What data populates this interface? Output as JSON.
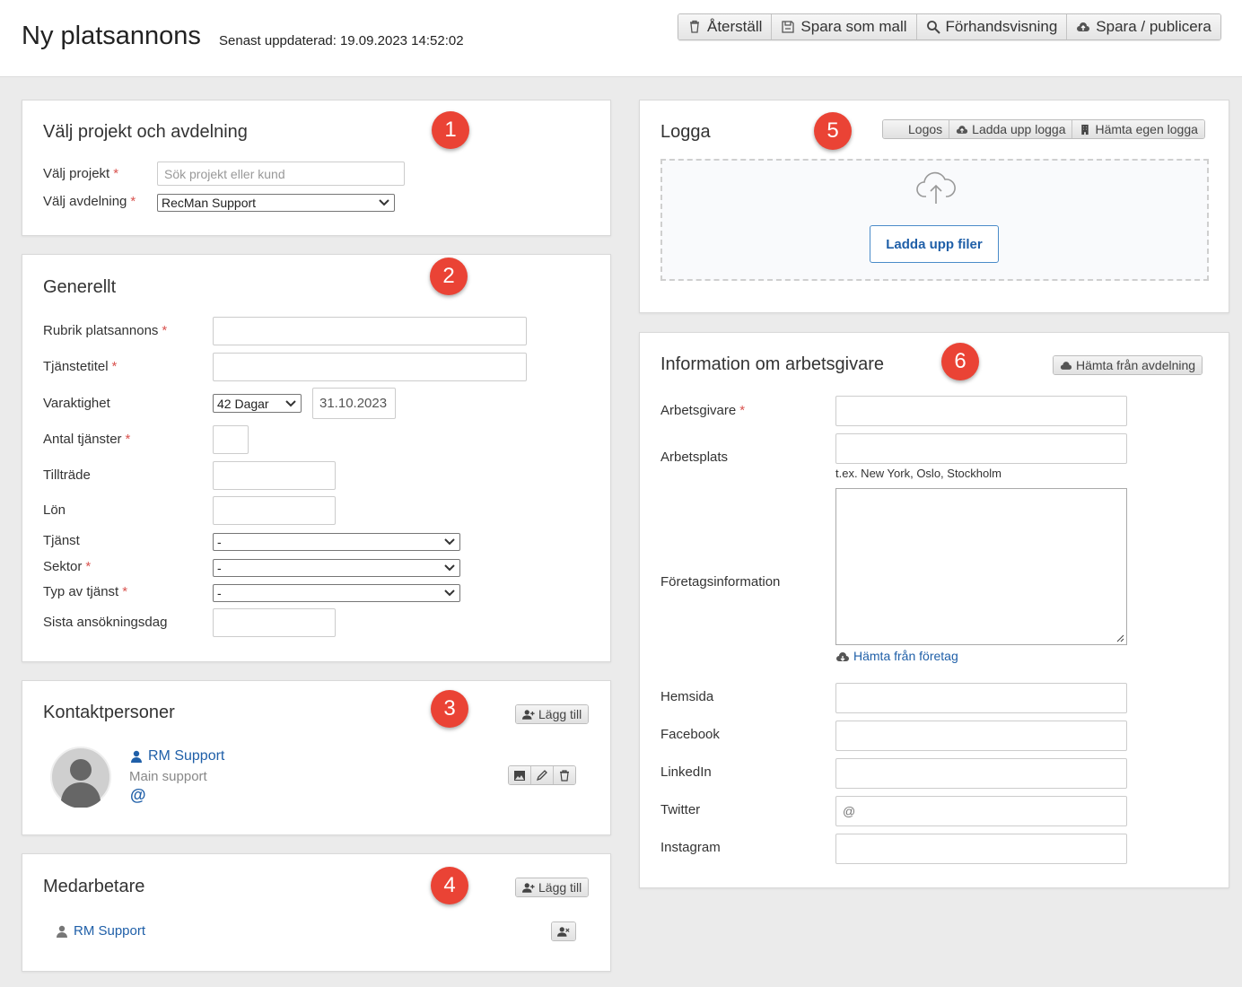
{
  "header": {
    "title": "Ny platsannons",
    "updated_label": "Senast uppdaterad:",
    "updated_value": "19.09.2023 14:52:02",
    "toolbar": [
      "Återställ",
      "Spara som mall",
      "Förhandsvisning",
      "Spara / publicera"
    ]
  },
  "project": {
    "badge": "1",
    "title": "Välj projekt och avdelning",
    "project_label": "Välj projekt",
    "project_placeholder": "Sök projekt eller kund",
    "department_label": "Välj avdelning",
    "department_value": "RecMan Support"
  },
  "general": {
    "badge": "2",
    "title": "Generellt",
    "fields": {
      "headline": "Rubrik platsannons",
      "job_title": "Tjänstetitel",
      "duration": "Varaktighet",
      "duration_value": "42 Dagar",
      "duration_date": "31.10.2023",
      "positions": "Antal tjänster",
      "start": "Tillträde",
      "salary": "Lön",
      "service": "Tjänst",
      "service_value": "-",
      "sector": "Sektor",
      "sector_value": "-",
      "type": "Typ av tjänst",
      "type_value": "-",
      "deadline": "Sista ansökningsdag"
    }
  },
  "contacts": {
    "badge": "3",
    "title": "Kontaktpersoner",
    "add_label": "Lägg till",
    "person_name": "RM Support",
    "person_role": "Main support",
    "email_symbol": "@"
  },
  "colleagues": {
    "badge": "4",
    "title": "Medarbetare",
    "add_label": "Lägg till",
    "person_name": "RM Support"
  },
  "logo": {
    "badge": "5",
    "title": "Logga",
    "buttons": [
      "Logos",
      "Ladda upp logga",
      "Hämta egen logga"
    ],
    "upload_label": "Ladda upp filer"
  },
  "employer": {
    "badge": "6",
    "title": "Information om arbetsgivare",
    "fetch_department": "Hämta från avdelning",
    "employer_label": "Arbetsgivare",
    "workplace_label": "Arbetsplats",
    "workplace_hint": "t.ex. New York, Oslo, Stockholm",
    "company_info_label": "Företagsinformation",
    "fetch_company": "Hämta från företag",
    "website_label": "Hemsida",
    "facebook_label": "Facebook",
    "linkedin_label": "LinkedIn",
    "twitter_label": "Twitter",
    "twitter_prefix": "@",
    "instagram_label": "Instagram"
  },
  "colors": {
    "badge": "#ea4335",
    "required": "#d9534f",
    "link": "#1f5fa8"
  }
}
